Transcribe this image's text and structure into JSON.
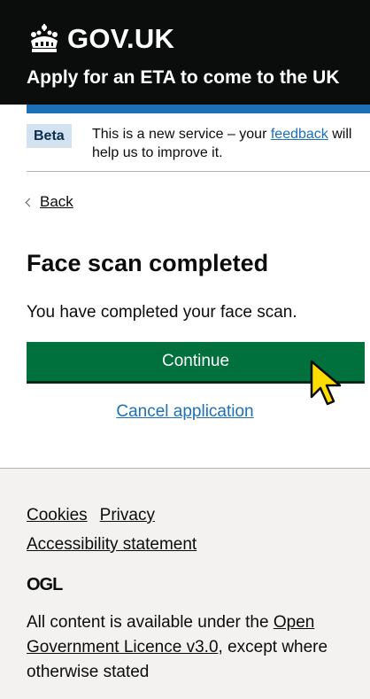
{
  "header": {
    "logo_text": "GOV.UK",
    "service_name": "Apply for an ETA to come to the UK"
  },
  "phase_banner": {
    "tag": "Beta",
    "text_before": "This is a new service – your ",
    "link": "feedback",
    "text_after": " will help us to improve it."
  },
  "back_link": "Back",
  "main": {
    "title": "Face scan completed",
    "body": "You have completed your face scan.",
    "continue_label": "Continue",
    "cancel_label": "Cancel application"
  },
  "footer": {
    "links": [
      "Cookies",
      "Privacy",
      "Accessibility statement"
    ],
    "ogl": "OGL",
    "licence_before": "All content is available under the ",
    "licence_link": "Open Government Licence v3.0",
    "licence_after": ", except where otherwise stated"
  },
  "colors": {
    "header_bg": "#0b0c0c",
    "blue_bar": "#1d70b8",
    "button_green": "#00703c",
    "link_blue": "#1d70b8",
    "footer_bg": "#f3f2f1",
    "cursor_yellow": "#ffdd00"
  },
  "icons": [
    "crown-icon",
    "chevron-left-icon",
    "cursor-icon"
  ]
}
